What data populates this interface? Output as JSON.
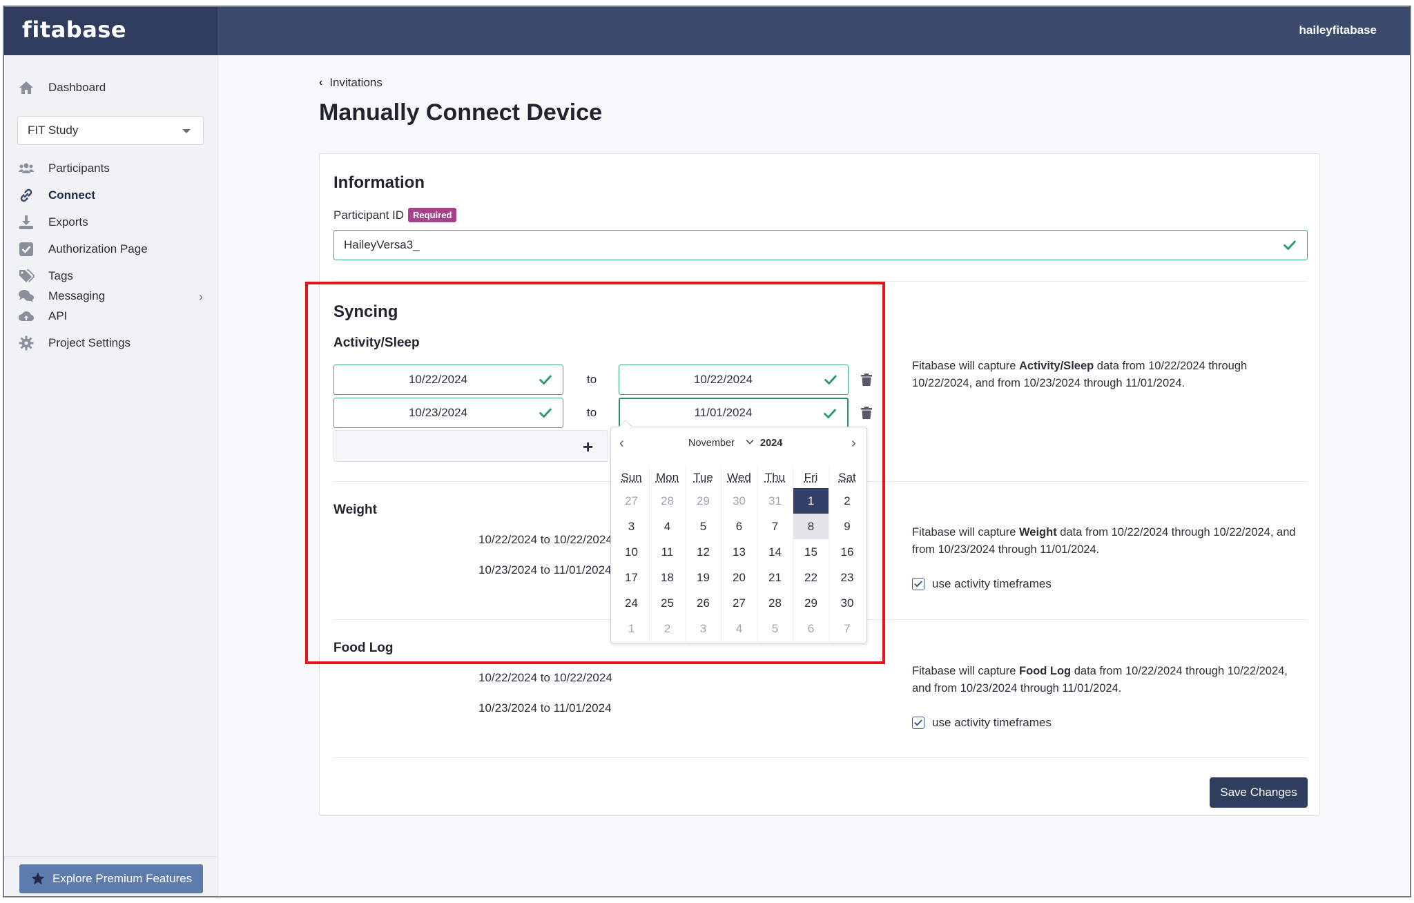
{
  "app": {
    "brand": "fitabase",
    "username": "haileyfitabase"
  },
  "sidebar": {
    "dashboard": "Dashboard",
    "study_select": "FIT Study",
    "items": [
      {
        "label": "Participants"
      },
      {
        "label": "Connect"
      },
      {
        "label": "Exports"
      },
      {
        "label": "Authorization Page"
      },
      {
        "label": "Tags"
      },
      {
        "label": "Messaging"
      },
      {
        "label": "API"
      },
      {
        "label": "Project Settings"
      }
    ],
    "premium_button": "Explore Premium Features"
  },
  "main": {
    "breadcrumb": "Invitations",
    "title": "Manually Connect Device",
    "information": {
      "heading": "Information",
      "participant_label": "Participant ID",
      "required_badge": "Required",
      "participant_value": "HaileyVersa3_"
    },
    "syncing": {
      "heading": "Syncing",
      "activity": {
        "heading": "Activity/Sleep",
        "rows": [
          {
            "from": "10/22/2024",
            "to_word": "to",
            "to": "10/22/2024"
          },
          {
            "from": "10/23/2024",
            "to_word": "to",
            "to": "11/01/2024"
          }
        ],
        "desc_prefix": "Fitabase will capture ",
        "desc_bold": "Activity/Sleep",
        "desc_suffix": " data from 10/22/2024 through 10/22/2024, and from 10/23/2024 through 11/01/2024."
      },
      "weight": {
        "heading": "Weight",
        "ranges": [
          "10/22/2024 to 10/22/2024",
          "10/23/2024 to 11/01/2024"
        ],
        "desc_prefix": "Fitabase will capture ",
        "desc_bold": "Weight",
        "desc_suffix": " data from 10/22/2024 through 10/22/2024, and from 10/23/2024 through 11/01/2024.",
        "checkbox_label": "use activity timeframes",
        "checked": true
      },
      "food": {
        "heading": "Food Log",
        "ranges": [
          "10/22/2024 to 10/22/2024",
          "10/23/2024 to 11/01/2024"
        ],
        "desc_prefix": "Fitabase will capture ",
        "desc_bold": "Food Log",
        "desc_suffix": " data from 10/22/2024 through 10/22/2024, and from 10/23/2024 through 11/01/2024.",
        "checkbox_label": "use activity timeframes",
        "checked": true
      }
    },
    "save_button": "Save Changes"
  },
  "calendar": {
    "month": "November",
    "year": "2024",
    "prev": "‹",
    "next": "›",
    "weekdays": [
      "Sun",
      "Mon",
      "Tue",
      "Wed",
      "Thu",
      "Fri",
      "Sat"
    ],
    "weeks": [
      [
        {
          "d": "27",
          "o": true
        },
        {
          "d": "28",
          "o": true
        },
        {
          "d": "29",
          "o": true
        },
        {
          "d": "30",
          "o": true
        },
        {
          "d": "31",
          "o": true
        },
        {
          "d": "1",
          "s": true
        },
        {
          "d": "2"
        }
      ],
      [
        {
          "d": "3"
        },
        {
          "d": "4"
        },
        {
          "d": "5"
        },
        {
          "d": "6"
        },
        {
          "d": "7"
        },
        {
          "d": "8",
          "t": true
        },
        {
          "d": "9"
        }
      ],
      [
        {
          "d": "10"
        },
        {
          "d": "11"
        },
        {
          "d": "12"
        },
        {
          "d": "13"
        },
        {
          "d": "14"
        },
        {
          "d": "15"
        },
        {
          "d": "16"
        }
      ],
      [
        {
          "d": "17"
        },
        {
          "d": "18"
        },
        {
          "d": "19"
        },
        {
          "d": "20"
        },
        {
          "d": "21"
        },
        {
          "d": "22"
        },
        {
          "d": "23"
        }
      ],
      [
        {
          "d": "24"
        },
        {
          "d": "25"
        },
        {
          "d": "26"
        },
        {
          "d": "27"
        },
        {
          "d": "28"
        },
        {
          "d": "29"
        },
        {
          "d": "30"
        }
      ],
      [
        {
          "d": "1",
          "o": true
        },
        {
          "d": "2",
          "o": true
        },
        {
          "d": "3",
          "o": true
        },
        {
          "d": "4",
          "o": true
        },
        {
          "d": "5",
          "o": true
        },
        {
          "d": "6",
          "o": true
        },
        {
          "d": "7",
          "o": true
        }
      ]
    ]
  },
  "colors": {
    "topbar": "#3c4a6e",
    "accent_green": "#3aa57a",
    "selected_day": "#33416a",
    "badge": "#a8428c",
    "annotation": "#e3151a"
  },
  "icons": {
    "dashboard": "home-icon",
    "participants": "users-icon",
    "connect": "link-icon",
    "exports": "download-icon",
    "authorization": "checkbox-icon",
    "tags": "tags-icon",
    "messaging": "comments-icon",
    "api": "cloud-upload-icon",
    "settings": "gear-icon"
  }
}
